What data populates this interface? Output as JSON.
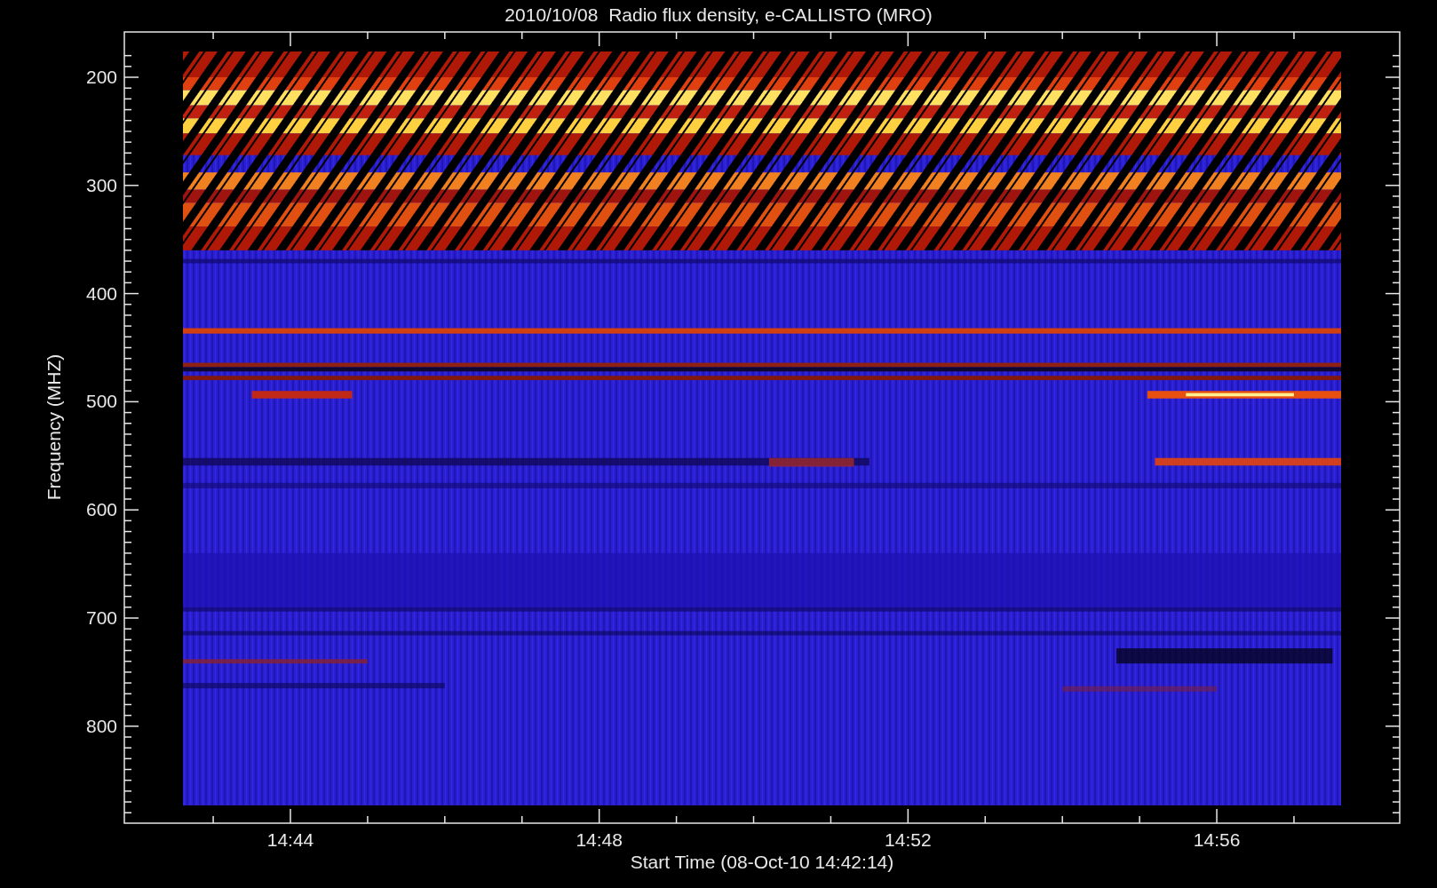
{
  "title": "2010/10/08  Radio flux density, e-CALLISTO (MRO)",
  "y_axis": {
    "label": "Frequency (MHZ)",
    "ticks": [
      "200",
      "300",
      "400",
      "500",
      "600",
      "700",
      "800"
    ]
  },
  "x_axis": {
    "label": "Start Time (08-Oct-10 14:42:14)",
    "ticks": [
      "14:44",
      "14:48",
      "14:52",
      "14:56"
    ]
  }
}
